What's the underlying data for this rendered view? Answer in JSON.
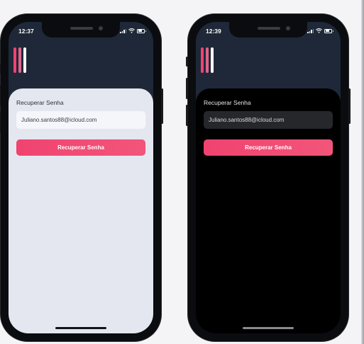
{
  "brand": {
    "accent": "#f04370",
    "accent_gradient_end": "#f2557a",
    "logo_bar_colors": [
      "#f04370",
      "#e0648a",
      "#ffffff"
    ]
  },
  "screens": [
    {
      "theme": "light",
      "status_time": "12:37",
      "title": "Recuperar Senha",
      "email_value": "Juliano.santos88@icloud.com",
      "button_label": "Recuperar Senha"
    },
    {
      "theme": "dark",
      "status_time": "12:39",
      "title": "Recuperar Senha",
      "email_value": "Juliano.santos88@icloud.com",
      "button_label": "Recuperar Senha"
    }
  ],
  "icons": [
    "signal-icon",
    "wifi-icon",
    "battery-icon"
  ]
}
